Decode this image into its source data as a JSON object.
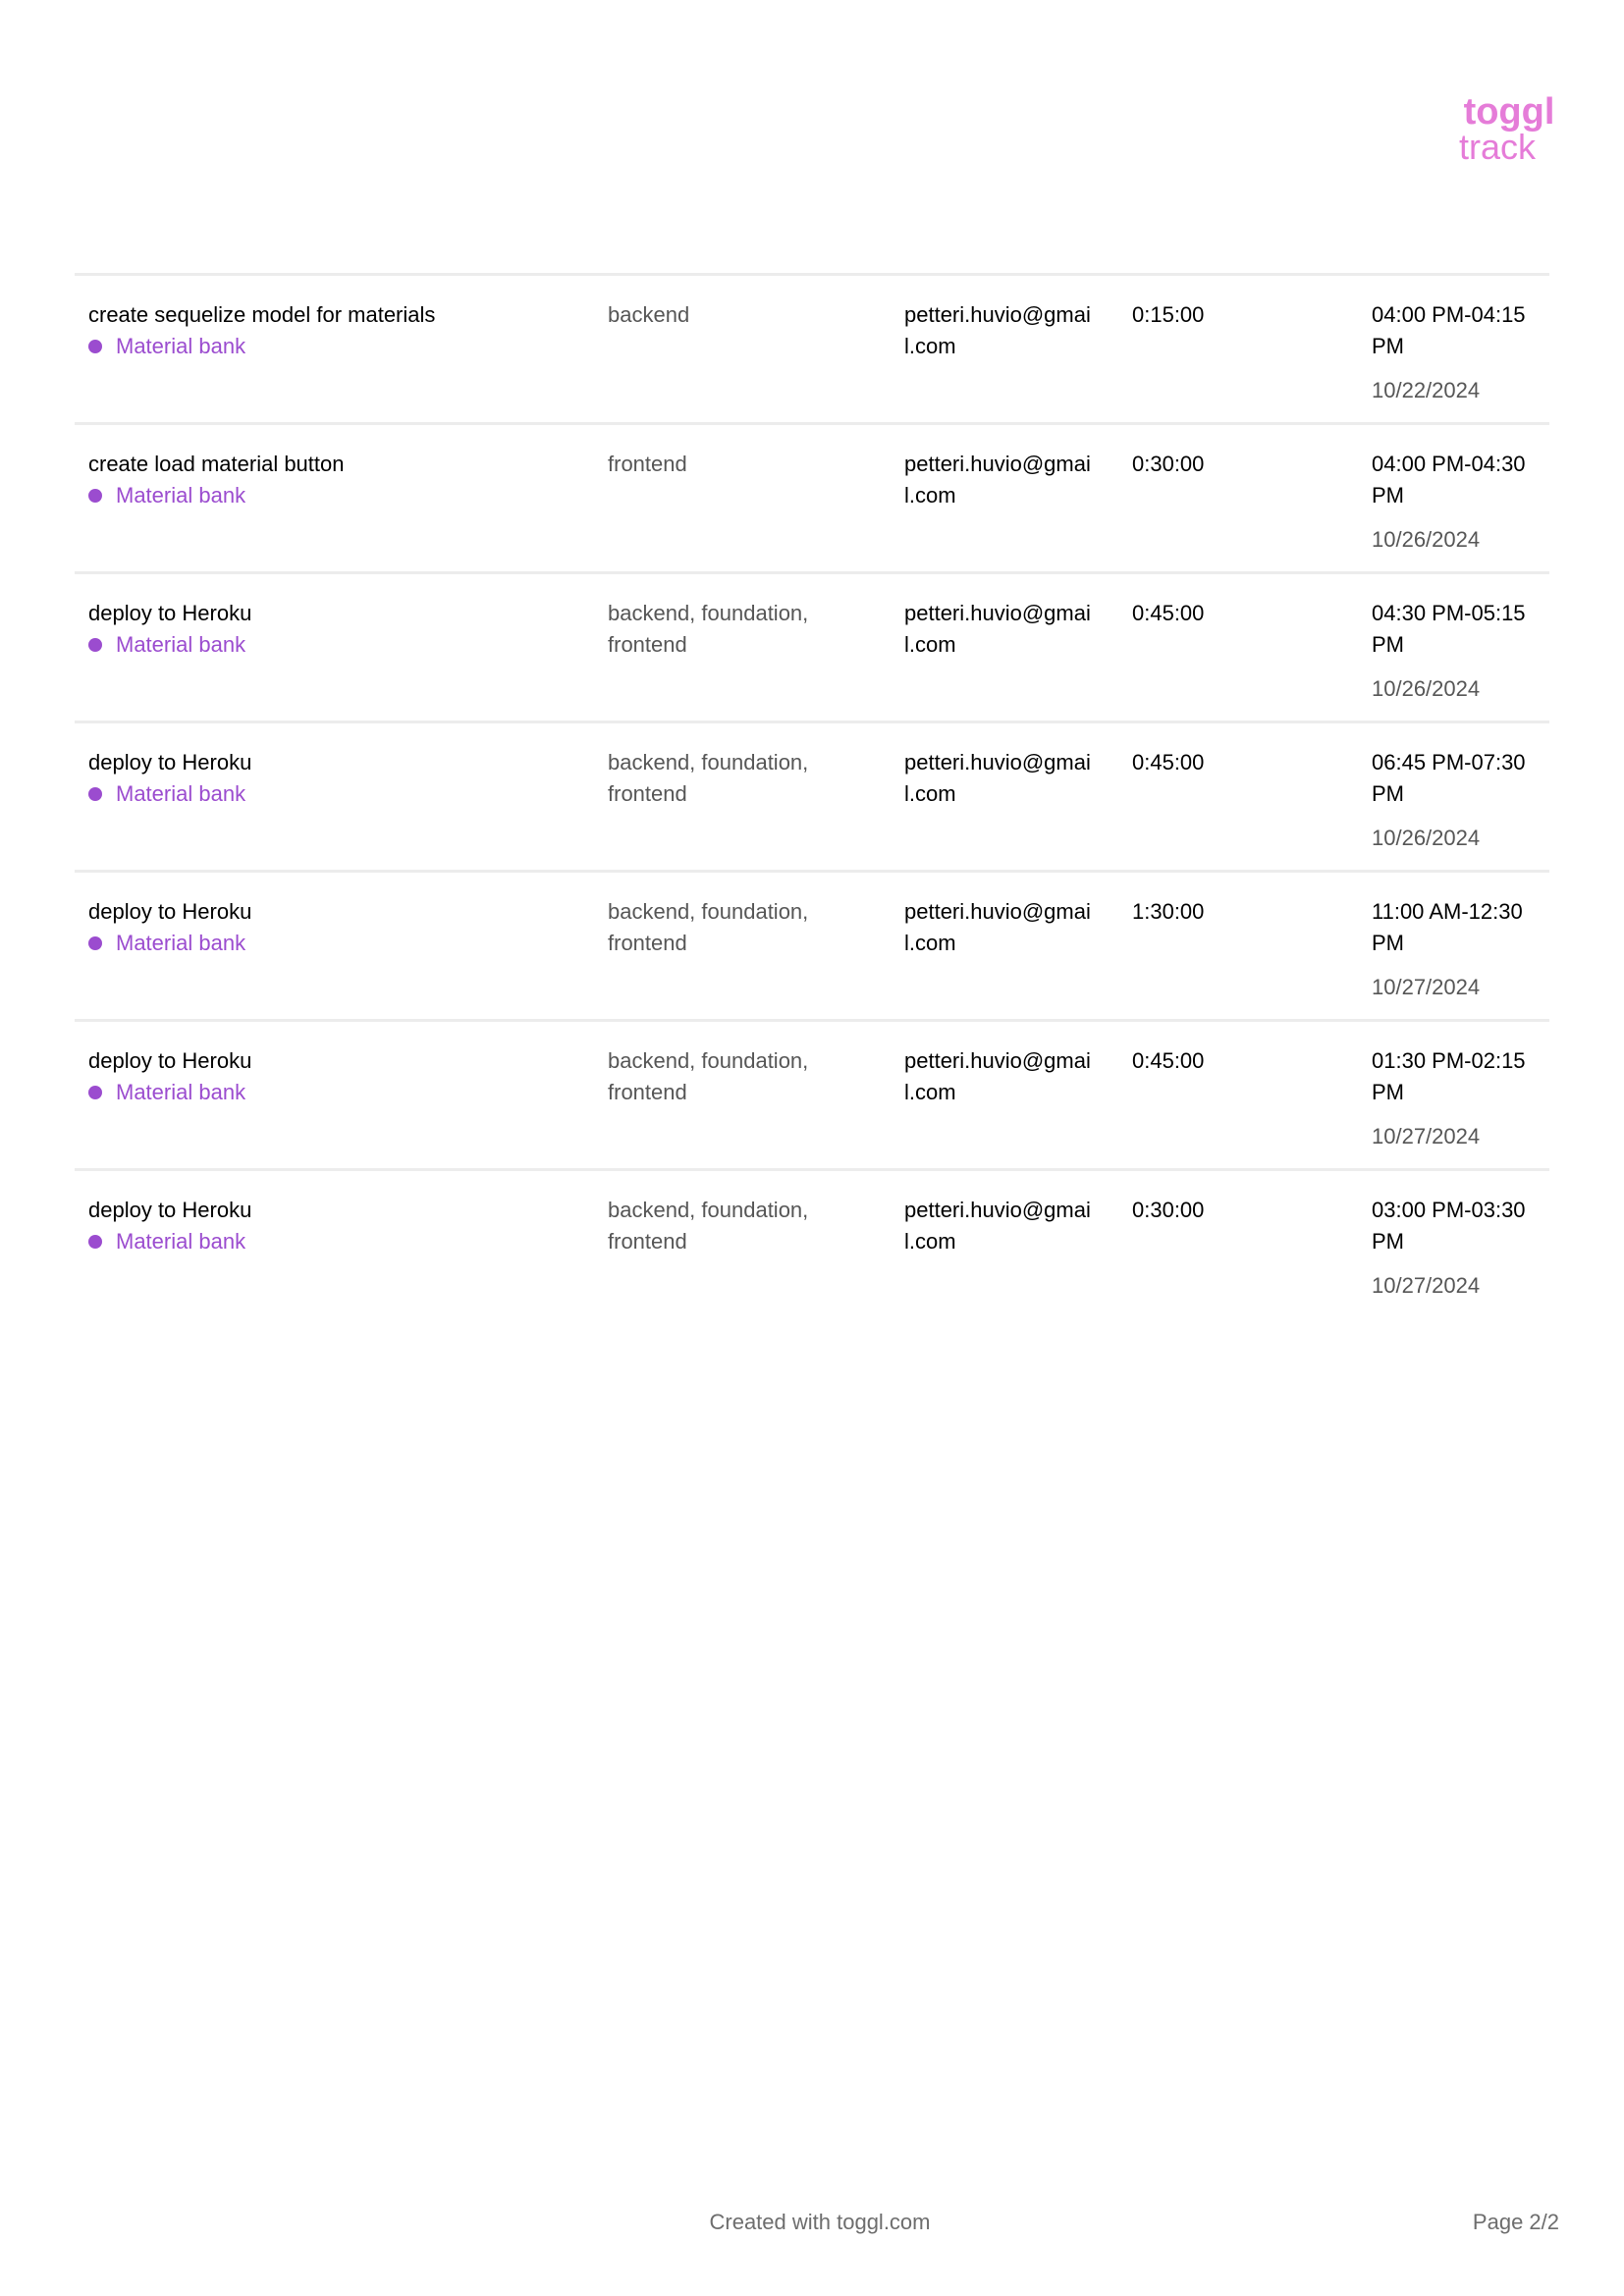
{
  "brand": {
    "logo_line1": "toggl",
    "logo_line2": "track",
    "accent_color": "#e57cd8"
  },
  "entries": [
    {
      "description": "create sequelize model for materials",
      "project": "Material bank",
      "tags": "backend",
      "user": "petteri.huvio@gmail.com",
      "duration": "0:15:00",
      "time_range": "04:00 PM-04:15 PM",
      "date": "10/22/2024"
    },
    {
      "description": "create load material button",
      "project": "Material bank",
      "tags": "frontend",
      "user": "petteri.huvio@gmail.com",
      "duration": "0:30:00",
      "time_range": "04:00 PM-04:30 PM",
      "date": "10/26/2024"
    },
    {
      "description": "deploy to Heroku",
      "project": "Material bank",
      "tags": "backend, foundation, frontend",
      "user": "petteri.huvio@gmail.com",
      "duration": "0:45:00",
      "time_range": "04:30 PM-05:15 PM",
      "date": "10/26/2024"
    },
    {
      "description": "deploy to Heroku",
      "project": "Material bank",
      "tags": "backend, foundation, frontend",
      "user": "petteri.huvio@gmail.com",
      "duration": "0:45:00",
      "time_range": "06:45 PM-07:30 PM",
      "date": "10/26/2024"
    },
    {
      "description": "deploy to Heroku",
      "project": "Material bank",
      "tags": "backend, foundation, frontend",
      "user": "petteri.huvio@gmail.com",
      "duration": "1:30:00",
      "time_range": "11:00 AM-12:30 PM",
      "date": "10/27/2024"
    },
    {
      "description": "deploy to Heroku",
      "project": "Material bank",
      "tags": "backend, foundation, frontend",
      "user": "petteri.huvio@gmail.com",
      "duration": "0:45:00",
      "time_range": "01:30 PM-02:15 PM",
      "date": "10/27/2024"
    },
    {
      "description": "deploy to Heroku",
      "project": "Material bank",
      "tags": "backend, foundation, frontend",
      "user": "petteri.huvio@gmail.com",
      "duration": "0:30:00",
      "time_range": "03:00 PM-03:30 PM",
      "date": "10/27/2024"
    }
  ],
  "project_color": "#9b4ccf",
  "footer": {
    "created_with": "Created with toggl.com",
    "page": "Page 2/2"
  }
}
